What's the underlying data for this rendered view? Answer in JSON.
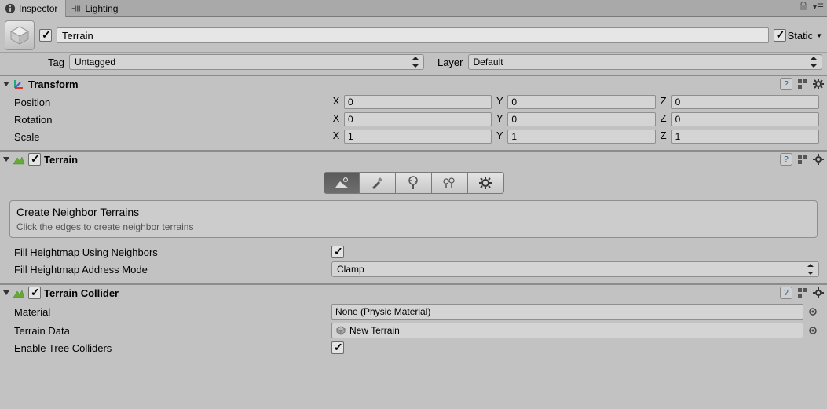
{
  "tabs": {
    "inspector": "Inspector",
    "lighting": "Lighting"
  },
  "gameObject": {
    "name": "Terrain",
    "active": true,
    "static": true,
    "static_label": "Static"
  },
  "tagLayer": {
    "tag_label": "Tag",
    "tag_value": "Untagged",
    "layer_label": "Layer",
    "layer_value": "Default"
  },
  "transform": {
    "title": "Transform",
    "position_label": "Position",
    "rotation_label": "Rotation",
    "scale_label": "Scale",
    "axis_x": "X",
    "axis_y": "Y",
    "axis_z": "Z",
    "position": {
      "x": "0",
      "y": "0",
      "z": "0"
    },
    "rotation": {
      "x": "0",
      "y": "0",
      "z": "0"
    },
    "scale": {
      "x": "1",
      "y": "1",
      "z": "1"
    }
  },
  "terrain": {
    "title": "Terrain",
    "enabled": true,
    "tool_title": "Create Neighbor Terrains",
    "tool_sub": "Click the edges to create neighbor terrains",
    "fill_label": "Fill Heightmap Using Neighbors",
    "fill_checked": true,
    "addr_label": "Fill Heightmap Address Mode",
    "addr_value": "Clamp"
  },
  "collider": {
    "title": "Terrain Collider",
    "enabled": true,
    "material_label": "Material",
    "material_value": "None (Physic Material)",
    "data_label": "Terrain Data",
    "data_value": "New Terrain",
    "tree_label": "Enable Tree Colliders",
    "tree_checked": true
  }
}
